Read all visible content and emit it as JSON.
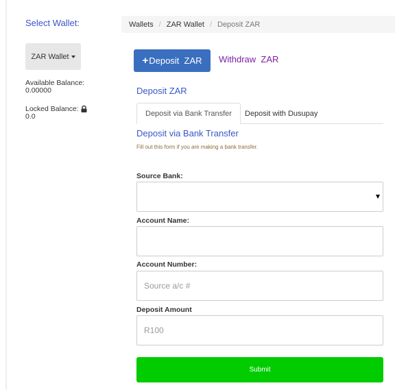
{
  "sidebar": {
    "select_wallet_label": "Select Wallet:",
    "wallet_dropdown_label": "ZAR Wallet",
    "available_balance_label": "Available Balance:",
    "available_balance_value": "0.00000",
    "locked_balance_label": "Locked Balance:",
    "locked_balance_value": "0.0",
    "lock_icon": "lock-icon"
  },
  "breadcrumb": {
    "items": [
      "Wallets",
      "ZAR Wallet",
      "Deposit ZAR"
    ],
    "separator": "/"
  },
  "actions": {
    "deposit_plus": "+",
    "deposit_label": "Deposit  ZAR",
    "withdraw_label": "Withdraw  ZAR"
  },
  "section_title": "Deposit ZAR",
  "tabs": [
    {
      "label": "Deposit via Bank Transfer",
      "active": true
    },
    {
      "label": "Deposit with Dusupay",
      "active": false
    }
  ],
  "form": {
    "title": "Deposit via Bank Transfer",
    "hint": "Fill out this form if you are making a bank transfer.",
    "source_bank": {
      "label": "Source Bank:",
      "value": ""
    },
    "account_name": {
      "label": "Account Name:",
      "value": "",
      "placeholder": ""
    },
    "account_number": {
      "label": "Account Number:",
      "value": "",
      "placeholder": "Source a/c #"
    },
    "deposit_amount": {
      "label": "Deposit Amount",
      "value": "",
      "placeholder": "R100"
    },
    "submit_label": "Submit"
  },
  "colors": {
    "link_blue": "#3a55c7",
    "deposit_button": "#3a6fbf",
    "withdraw_link": "#7b1fa2",
    "submit_button": "#00cc00",
    "hint_text": "#8a6d3b"
  }
}
